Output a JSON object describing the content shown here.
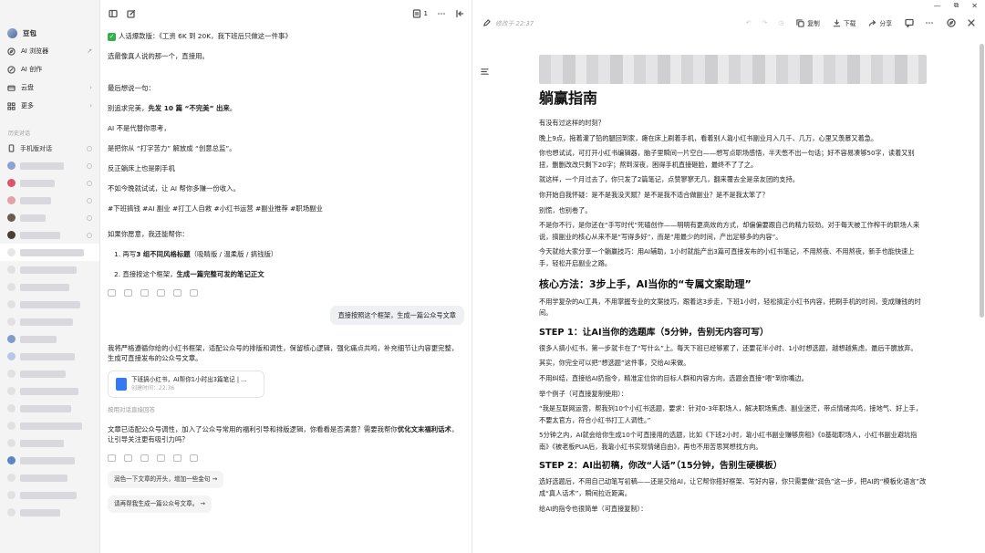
{
  "window": {
    "min": "—",
    "max": "⧉",
    "close": "✕"
  },
  "sidebar": {
    "app_name": "豆包",
    "nav": [
      {
        "label": "AI 浏览器",
        "arrow": "↗"
      },
      {
        "label": "AI 创作",
        "arrow": ""
      },
      {
        "label": "云盘",
        "arrow": "›"
      },
      {
        "label": "更多",
        "arrow": "›"
      }
    ],
    "history_title": "历史对话",
    "history_first": "手机版对话"
  },
  "chat": {
    "head_count": "1",
    "m1": "人话爆款版：《工资 6K 到 20K，我下班后只做这一件事》",
    "m2": "选最像真人说的那一个，直接用。",
    "m3": "最后想说一句：",
    "m4a": "别追求完美，",
    "m4b": "先发 10 篇 “不完美” 出来",
    "m4c": "。",
    "m5": "AI 不是代替你思考，",
    "m6": "是把你从 “打字苦力” 解放成 “创意总监”。",
    "m7": "反正躺床上也是刷手机",
    "m8": "不如今晚就试试，让 AI 帮你多赚一份收入。",
    "tags": "#下班搞钱 #AI 副业 #打工人自救 #小红书运营 #副业推荐 #职场副业",
    "help_title": "如果你愿意，我还能帮你：",
    "li1a": "1. 再写",
    "li1b": "3 组不同风格标题",
    "li1c": "（吸睛版 / 温柔版 / 搞钱版）",
    "li2a": "2. 直接按这个框架，",
    "li2b": "生成一篇完整可发的笔记正文",
    "user_msg": "直接按照这个框架，生成一篇公众号文章",
    "reply1": "我将严格遵循你给的小红书框架，适配公众号的排版和调性，保留核心逻辑，强化痛点共鸣，补充细节让内容更完整，生成可直接发布的公众号文章。",
    "card_title": "下班搞小红书，AI帮你1小时出3篇笔记 | ...",
    "card_sub": "创建时间：22:36",
    "refs": "按用对话直接回答",
    "reply2a": "文章已适配公众号调性，加入了公众号常用的福利引导和排版逻辑，你看看是否满意？需要我帮你",
    "reply2b": "优化文末福利话术",
    "reply2c": "，让引导关注更有吸引力吗？",
    "sug1": "润色一下文章的开头，增加一些金句 →",
    "sug2": "请再帮我生成一篇公众号文章。 →"
  },
  "doc": {
    "saved": "修改于 22:37",
    "copy": "复制",
    "download": "下载",
    "share": "分享",
    "title": "躺赢指南",
    "p1": "有没有过这样的时刻？",
    "p2": "晚上9点，拖着灌了铅的腿回到家，瘫在床上刷着手机，看着别人靠小红书副业月入几千、几万，心里又羡慕又着急。",
    "p3": "你也想试试，可打开小红书编辑器，脑子里瞬间一片空白——想写点职场感悟，半天憋不出一句话；好不容易凑够50字，读着又别扭，删删改改只剩下20字；熬到深夜，困得手机直接砸脸，最终不了了之。",
    "p4": "就这样，一个月过去了，你只发了2篇笔记，点赞寥寥无几，翻来覆去全是亲友团的支持。",
    "p5": "你开始自我怀疑：是不是我没天赋？是不是我不适合做副业？是不是我太笨了？",
    "p6": "别慌，也别卷了。",
    "p7": "不是你不行，是你还在“手写时代”死磕创作——明明有更高效的方式，却偏偏要跟自己的精力较劲。对于每天被工作榨干的职场人来说，搞副业的核心从来不是“写得多好”，而是“用最少的时间，产出足够多的内容”。",
    "p8": "今天就给大家分享一个躺赢技巧：用AI辅助，1小时就能产出3篇可直接发布的小红书笔记，不用熬夜、不用熬夜，新手也能快速上手，轻松开启副业之路。",
    "h2_1": "核心方法：3步上手，AI当你的“专属文案助理”",
    "p9": "不用学复杂的AI工具，不用掌握专业的文案技巧，跟着这3步走，下班1小时，轻松搞定小红书内容，把刷手机的时间，变成赚钱的时间。",
    "h3_1": "STEP 1：让AI当你的选题库（5分钟，告别无内容可写）",
    "p10": "很多人搞小红书，第一步就卡在了“写什么”上。每天下班已经够累了，还要花半小时、1小时想选题，越想越焦虑，最后干脆放弃。",
    "p11": "其实，你完全可以把“想选题”这件事，交给AI来做。",
    "p12": "不用纠结，直接给AI扔指令，精准定位你的目标人群和内容方向，选题会直接“喂”到你嘴边。",
    "p13": "举个例子（可直接复制使用）：",
    "p14": "“我是互联网运营，帮我列10个小红书选题，要求：针对0-3年职场人，解决职场焦虑、副业迷茫，带点情绪共鸣，接地气、好上手，不要太官方，符合小红书打工人调性。”",
    "p15": "5分钟之内，AI就会给你生成10个可直接用的选题，比如《下班2小时，靠小红书副业赚够房租》《0基础职场人，小红书副业避坑指南》《被老板PUA后，我靠小红书实现情绪自由》，再也不用苦思冥想找方向。",
    "h3_2": "STEP 2：AI出初稿，你改“人话”（15分钟，告别生硬模板）",
    "p16": "选好选题后，不用自己动笔写初稿——还是交给AI，让它帮你搭好框架、写好内容，你只需要做“润色”这一步，把AI的“模板化语言”改成“真人话术”，瞬间拉近距离。",
    "p17": "给AI的指令也很简单（可直接复制）："
  }
}
